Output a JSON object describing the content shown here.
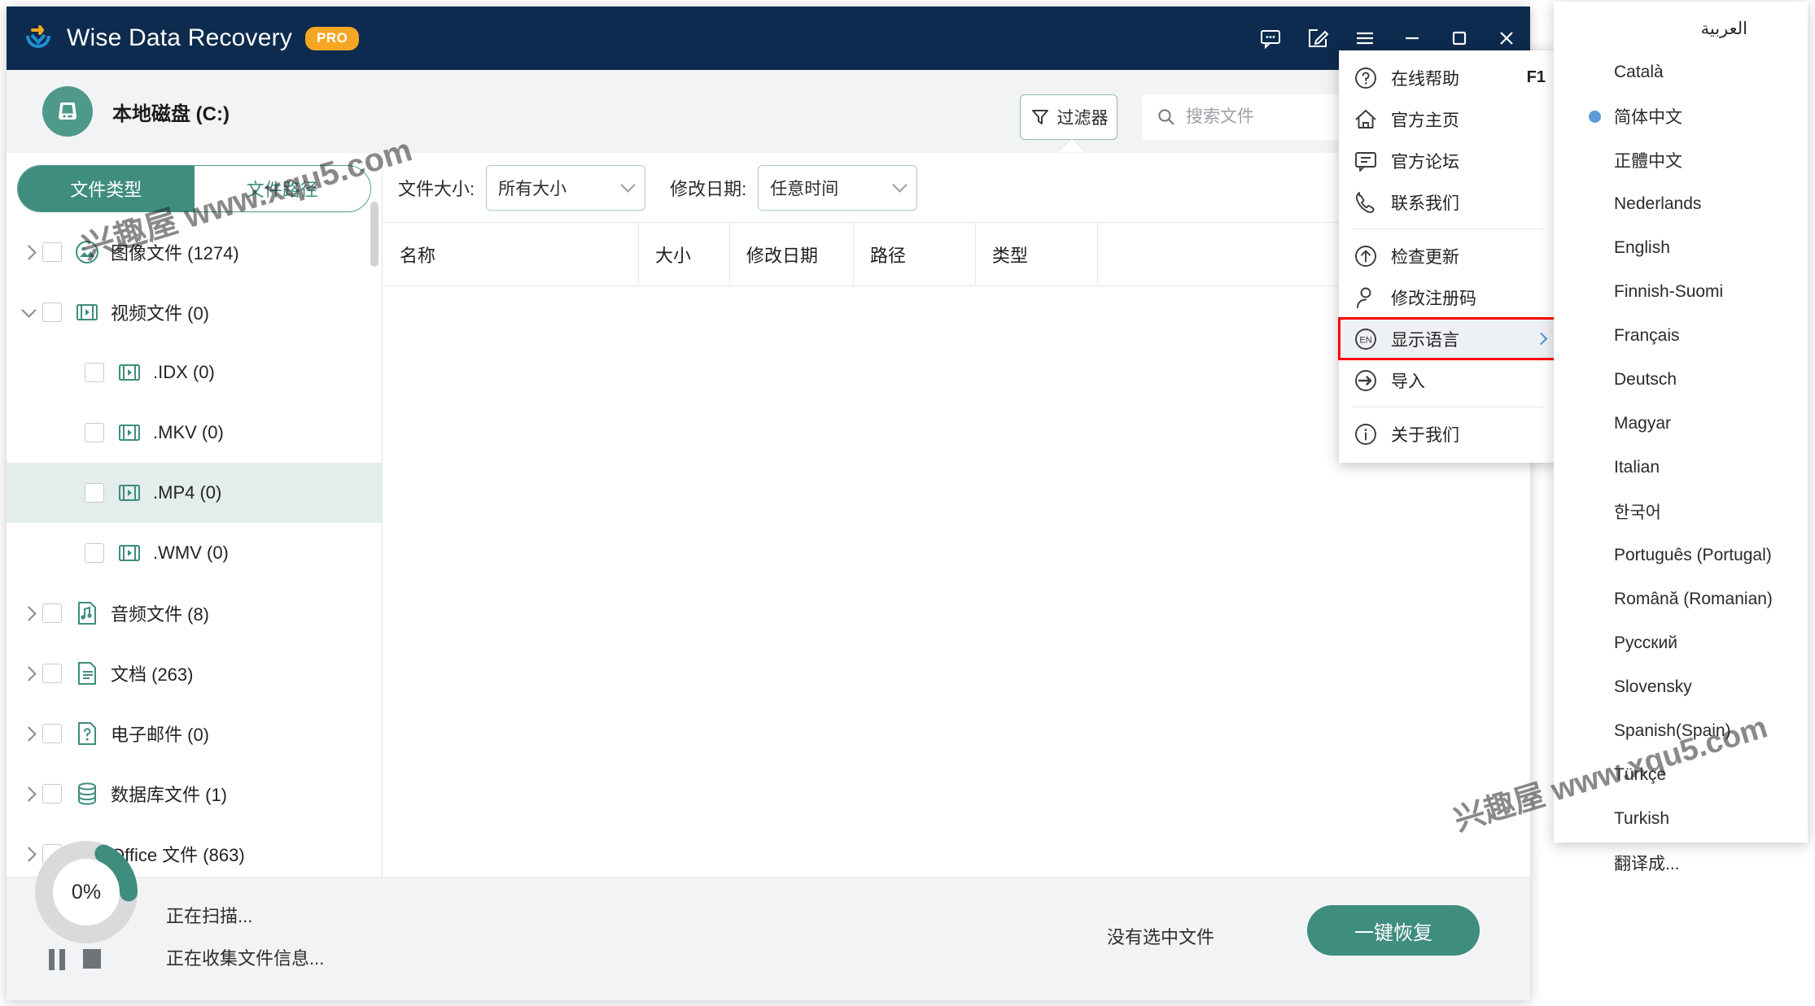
{
  "window": {
    "app_title": "Wise Data Recovery",
    "pro_badge": "PRO",
    "icons": {
      "feedback": "feedback-icon",
      "edit": "edit-icon",
      "menu": "hamburger-menu-icon",
      "minimize": "minimize-icon",
      "maximize": "maximize-icon",
      "close": "close-icon"
    }
  },
  "header": {
    "disk_label": "本地磁盘 (C:)",
    "disk_icon": "hard-disk-icon",
    "filter_button": "过滤器",
    "filter_icon": "funnel-icon",
    "search_placeholder": "搜索文件",
    "search_value": "",
    "search_icon": "search-icon"
  },
  "sidebar": {
    "tabs": [
      {
        "label": "文件类型",
        "active": true
      },
      {
        "label": "文件路径",
        "active": false
      }
    ],
    "tree": [
      {
        "label": "图像文件 (1274)",
        "level": 0,
        "caret": "right",
        "icon": "image-file-icon",
        "selected": false
      },
      {
        "label": "视频文件 (0)",
        "level": 0,
        "caret": "down",
        "icon": "video-file-icon",
        "selected": false
      },
      {
        "label": ".IDX (0)",
        "level": 1,
        "caret": "none",
        "icon": "video-file-icon",
        "selected": false
      },
      {
        "label": ".MKV (0)",
        "level": 1,
        "caret": "none",
        "icon": "video-file-icon",
        "selected": false
      },
      {
        "label": ".MP4 (0)",
        "level": 1,
        "caret": "none",
        "icon": "video-file-icon",
        "selected": true
      },
      {
        "label": ".WMV (0)",
        "level": 1,
        "caret": "none",
        "icon": "video-file-icon",
        "selected": false
      },
      {
        "label": "音频文件 (8)",
        "level": 0,
        "caret": "right",
        "icon": "audio-file-icon",
        "selected": false
      },
      {
        "label": "文档 (263)",
        "level": 0,
        "caret": "right",
        "icon": "document-file-icon",
        "selected": false
      },
      {
        "label": "电子邮件 (0)",
        "level": 0,
        "caret": "right",
        "icon": "email-file-icon",
        "selected": false
      },
      {
        "label": "数据库文件 (1)",
        "level": 0,
        "caret": "right",
        "icon": "database-file-icon",
        "selected": false
      },
      {
        "label": "Office 文件 (863)",
        "level": 0,
        "caret": "right",
        "icon": "office-file-icon",
        "selected": false
      }
    ]
  },
  "filter_bar": {
    "size_label": "文件大小:",
    "size_value": "所有大小",
    "date_label": "修改日期:",
    "date_value": "任意时间"
  },
  "table": {
    "columns": [
      "名称",
      "大小",
      "修改日期",
      "路径",
      "类型",
      ""
    ],
    "rows": []
  },
  "status": {
    "progress_percent": "0%",
    "progress_value": 18,
    "scanning_text": "正在扫描...",
    "collecting_text": "正在收集文件信息...",
    "pause_icon": "pause-icon",
    "stop_icon": "stop-icon",
    "no_selection_text": "没有选中文件",
    "recover_button": "一键恢复"
  },
  "menu": {
    "items": [
      {
        "label": "在线帮助",
        "icon": "help-circle-icon",
        "shortcut": "F1",
        "arrow": false,
        "highlight": false
      },
      {
        "label": "官方主页",
        "icon": "home-icon",
        "shortcut": "",
        "arrow": false,
        "highlight": false
      },
      {
        "label": "官方论坛",
        "icon": "forum-icon",
        "shortcut": "",
        "arrow": false,
        "highlight": false
      },
      {
        "label": "联系我们",
        "icon": "phone-icon",
        "shortcut": "",
        "arrow": false,
        "highlight": false
      },
      {
        "separator": true
      },
      {
        "label": "检查更新",
        "icon": "update-arrow-icon",
        "shortcut": "",
        "arrow": false,
        "highlight": false
      },
      {
        "label": "修改注册码",
        "icon": "user-icon",
        "shortcut": "",
        "arrow": false,
        "highlight": false
      },
      {
        "label": "显示语言",
        "icon": "language-en-icon",
        "shortcut": "",
        "arrow": true,
        "highlight": true
      },
      {
        "label": "导入",
        "icon": "import-icon",
        "shortcut": "",
        "arrow": false,
        "highlight": false
      },
      {
        "separator": true
      },
      {
        "label": "关于我们",
        "icon": "info-icon",
        "shortcut": "",
        "arrow": false,
        "highlight": false
      }
    ]
  },
  "language_menu": {
    "items": [
      {
        "label": "العربية",
        "selected": false,
        "rtl": true
      },
      {
        "label": "Català",
        "selected": false
      },
      {
        "label": "简体中文",
        "selected": true
      },
      {
        "label": "正體中文",
        "selected": false
      },
      {
        "label": "Nederlands",
        "selected": false
      },
      {
        "label": "English",
        "selected": false
      },
      {
        "label": "Finnish-Suomi",
        "selected": false
      },
      {
        "label": "Français",
        "selected": false
      },
      {
        "label": "Deutsch",
        "selected": false
      },
      {
        "label": "Magyar",
        "selected": false
      },
      {
        "label": "Italian",
        "selected": false
      },
      {
        "label": "한국어",
        "selected": false
      },
      {
        "label": "Português (Portugal)",
        "selected": false
      },
      {
        "label": "Română (Romanian)",
        "selected": false
      },
      {
        "label": "Русский",
        "selected": false
      },
      {
        "label": "Slovensky",
        "selected": false
      },
      {
        "label": "Spanish(Spain)",
        "selected": false
      },
      {
        "label": "Türkçe",
        "selected": false
      },
      {
        "label": "Turkish",
        "selected": false
      },
      {
        "label": "翻译成...",
        "selected": false
      }
    ]
  },
  "watermarks": {
    "top": "兴趣屋 www.xqu5.com",
    "bottom": "兴趣屋 www.xqu5.com"
  },
  "colors": {
    "titlebar": "#0d2b4e",
    "accent_green": "#3f8d7e",
    "pro_orange": "#f5a623",
    "highlight_red": "#ff0000",
    "selected_blue": "#5b9bd5"
  }
}
